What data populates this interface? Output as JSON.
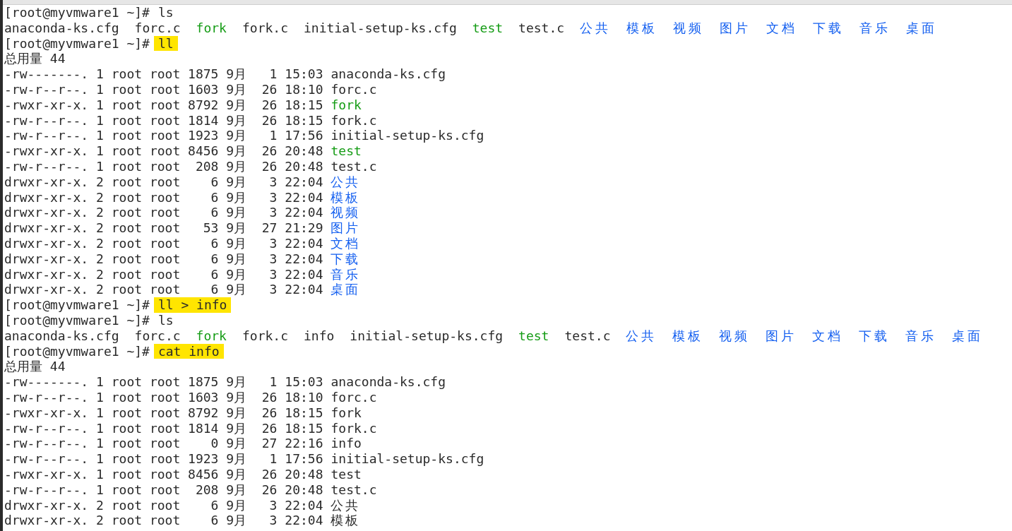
{
  "lines": [
    {
      "kind": "prompt",
      "prompt": "[root@myvmware1 ~]#",
      "command": "ls",
      "highlighted": false
    },
    {
      "kind": "listing",
      "items": [
        {
          "name": "anaconda-ks.cfg",
          "color": "#2a2a2a"
        },
        {
          "name": "forc.c",
          "color": "#2a2a2a"
        },
        {
          "name": "fork",
          "color": "#159c15"
        },
        {
          "name": "fork.c",
          "color": "#2a2a2a"
        },
        {
          "name": "initial-setup-ks.cfg",
          "color": "#2a2a2a"
        },
        {
          "name": "test",
          "color": "#159c15"
        },
        {
          "name": "test.c",
          "color": "#2a2a2a"
        },
        {
          "name": "公共",
          "color": "#1560f0"
        },
        {
          "name": "模板",
          "color": "#1560f0"
        },
        {
          "name": "视频",
          "color": "#1560f0"
        },
        {
          "name": "图片",
          "color": "#1560f0"
        },
        {
          "name": "文档",
          "color": "#1560f0"
        },
        {
          "name": "下载",
          "color": "#1560f0"
        },
        {
          "name": "音乐",
          "color": "#1560f0"
        },
        {
          "name": "桌面",
          "color": "#1560f0"
        }
      ]
    },
    {
      "kind": "prompt",
      "prompt": "[root@myvmware1 ~]#",
      "command": "ll",
      "highlighted": true
    },
    {
      "kind": "text",
      "text": "总用量 44"
    },
    {
      "kind": "entry",
      "info": "-rw-------. 1 root root 1875 9月   1 15:03",
      "name": "anaconda-ks.cfg",
      "color": "#2a2a2a"
    },
    {
      "kind": "entry",
      "info": "-rw-r--r--. 1 root root 1603 9月  26 18:10",
      "name": "forc.c",
      "color": "#2a2a2a"
    },
    {
      "kind": "entry",
      "info": "-rwxr-xr-x. 1 root root 8792 9月  26 18:15",
      "name": "fork",
      "color": "#159c15"
    },
    {
      "kind": "entry",
      "info": "-rw-r--r--. 1 root root 1814 9月  26 18:15",
      "name": "fork.c",
      "color": "#2a2a2a"
    },
    {
      "kind": "entry",
      "info": "-rw-r--r--. 1 root root 1923 9月   1 17:56",
      "name": "initial-setup-ks.cfg",
      "color": "#2a2a2a"
    },
    {
      "kind": "entry",
      "info": "-rwxr-xr-x. 1 root root 8456 9月  26 20:48",
      "name": "test",
      "color": "#159c15"
    },
    {
      "kind": "entry",
      "info": "-rw-r--r--. 1 root root  208 9月  26 20:48",
      "name": "test.c",
      "color": "#2a2a2a"
    },
    {
      "kind": "entry",
      "info": "drwxr-xr-x. 2 root root    6 9月   3 22:04",
      "name": "公共",
      "color": "#1560f0"
    },
    {
      "kind": "entry",
      "info": "drwxr-xr-x. 2 root root    6 9月   3 22:04",
      "name": "模板",
      "color": "#1560f0"
    },
    {
      "kind": "entry",
      "info": "drwxr-xr-x. 2 root root    6 9月   3 22:04",
      "name": "视频",
      "color": "#1560f0"
    },
    {
      "kind": "entry",
      "info": "drwxr-xr-x. 2 root root   53 9月  27 21:29",
      "name": "图片",
      "color": "#1560f0"
    },
    {
      "kind": "entry",
      "info": "drwxr-xr-x. 2 root root    6 9月   3 22:04",
      "name": "文档",
      "color": "#1560f0"
    },
    {
      "kind": "entry",
      "info": "drwxr-xr-x. 2 root root    6 9月   3 22:04",
      "name": "下载",
      "color": "#1560f0"
    },
    {
      "kind": "entry",
      "info": "drwxr-xr-x. 2 root root    6 9月   3 22:04",
      "name": "音乐",
      "color": "#1560f0"
    },
    {
      "kind": "entry",
      "info": "drwxr-xr-x. 2 root root    6 9月   3 22:04",
      "name": "桌面",
      "color": "#1560f0"
    },
    {
      "kind": "prompt",
      "prompt": "[root@myvmware1 ~]#",
      "command": "ll > info",
      "highlighted": true
    },
    {
      "kind": "prompt",
      "prompt": "[root@myvmware1 ~]#",
      "command": "ls",
      "highlighted": false
    },
    {
      "kind": "listing",
      "items": [
        {
          "name": "anaconda-ks.cfg",
          "color": "#2a2a2a"
        },
        {
          "name": "forc.c",
          "color": "#2a2a2a"
        },
        {
          "name": "fork",
          "color": "#159c15"
        },
        {
          "name": "fork.c",
          "color": "#2a2a2a"
        },
        {
          "name": "info",
          "color": "#2a2a2a"
        },
        {
          "name": "initial-setup-ks.cfg",
          "color": "#2a2a2a"
        },
        {
          "name": "test",
          "color": "#159c15"
        },
        {
          "name": "test.c",
          "color": "#2a2a2a"
        },
        {
          "name": "公共",
          "color": "#1560f0"
        },
        {
          "name": "模板",
          "color": "#1560f0"
        },
        {
          "name": "视频",
          "color": "#1560f0"
        },
        {
          "name": "图片",
          "color": "#1560f0"
        },
        {
          "name": "文档",
          "color": "#1560f0"
        },
        {
          "name": "下载",
          "color": "#1560f0"
        },
        {
          "name": "音乐",
          "color": "#1560f0"
        },
        {
          "name": "桌面",
          "color": "#1560f0"
        }
      ]
    },
    {
      "kind": "prompt",
      "prompt": "[root@myvmware1 ~]#",
      "command": "cat info",
      "highlighted": true
    },
    {
      "kind": "text",
      "text": "总用量 44"
    },
    {
      "kind": "entry",
      "info": "-rw-------. 1 root root 1875 9月   1 15:03",
      "name": "anaconda-ks.cfg",
      "color": "#2a2a2a"
    },
    {
      "kind": "entry",
      "info": "-rw-r--r--. 1 root root 1603 9月  26 18:10",
      "name": "forc.c",
      "color": "#2a2a2a"
    },
    {
      "kind": "entry",
      "info": "-rwxr-xr-x. 1 root root 8792 9月  26 18:15",
      "name": "fork",
      "color": "#2a2a2a"
    },
    {
      "kind": "entry",
      "info": "-rw-r--r--. 1 root root 1814 9月  26 18:15",
      "name": "fork.c",
      "color": "#2a2a2a"
    },
    {
      "kind": "entry",
      "info": "-rw-r--r--. 1 root root    0 9月  27 22:16",
      "name": "info",
      "color": "#2a2a2a"
    },
    {
      "kind": "entry",
      "info": "-rw-r--r--. 1 root root 1923 9月   1 17:56",
      "name": "initial-setup-ks.cfg",
      "color": "#2a2a2a"
    },
    {
      "kind": "entry",
      "info": "-rwxr-xr-x. 1 root root 8456 9月  26 20:48",
      "name": "test",
      "color": "#2a2a2a"
    },
    {
      "kind": "entry",
      "info": "-rw-r--r--. 1 root root  208 9月  26 20:48",
      "name": "test.c",
      "color": "#2a2a2a"
    },
    {
      "kind": "entry",
      "info": "drwxr-xr-x. 2 root root    6 9月   3 22:04",
      "name": "公共",
      "color": "#2a2a2a"
    },
    {
      "kind": "entry",
      "info": "drwxr-xr-x. 2 root root    6 9月   3 22:04",
      "name": "模板",
      "color": "#2a2a2a"
    }
  ]
}
